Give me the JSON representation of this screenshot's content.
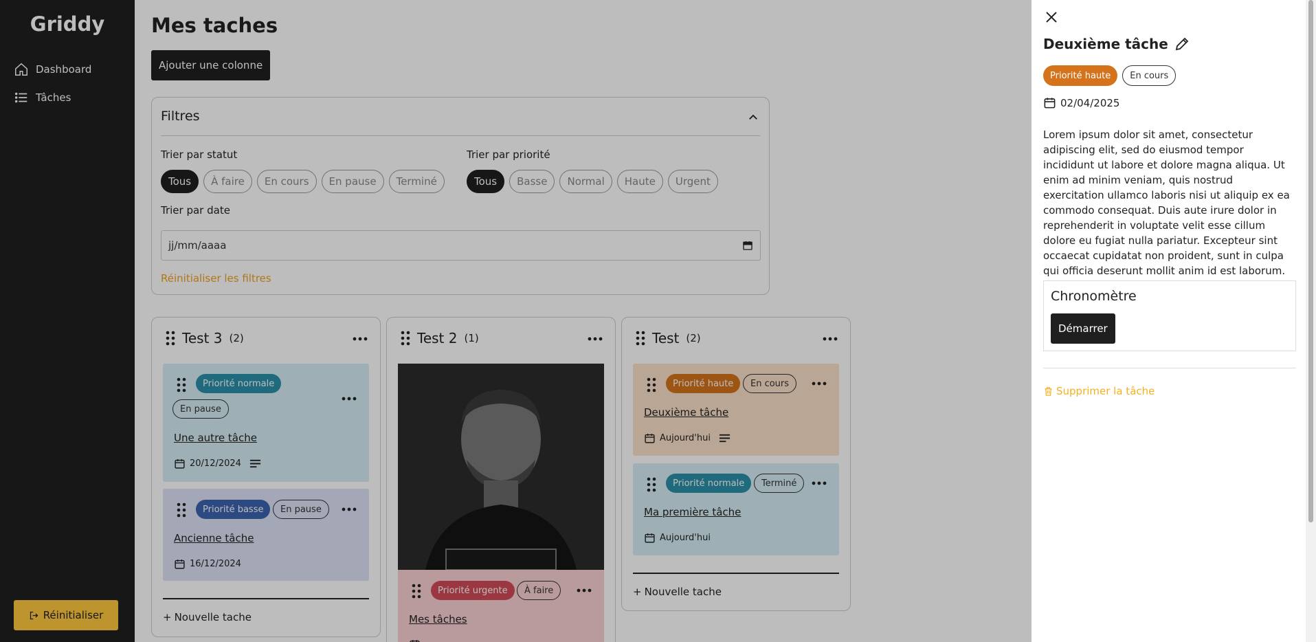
{
  "sidebar": {
    "logo": "Griddy",
    "nav": [
      {
        "label": "Dashboard",
        "icon": "home-icon"
      },
      {
        "label": "Tâches",
        "icon": "list-icon"
      }
    ],
    "reset_label": "Réinitialiser"
  },
  "main": {
    "title": "Mes taches",
    "add_column_label": "Ajouter une colonne",
    "filters": {
      "title": "Filtres",
      "status_label": "Trier par statut",
      "status_options": [
        "Tous",
        "À faire",
        "En cours",
        "En pause",
        "Terminé"
      ],
      "priority_label": "Trier par priorité",
      "priority_options": [
        "Tous",
        "Basse",
        "Normal",
        "Haute",
        "Urgent"
      ],
      "date_label": "Trier par date",
      "date_placeholder": "jj/mm/aaaa",
      "reset_label": "Réinitialiser les filtres"
    },
    "columns": [
      {
        "title": "Test 3",
        "count": "(2)",
        "new_task_label": "Nouvelle tache",
        "cards": [
          {
            "priority": "Priorité normale",
            "status": "En pause",
            "title": "Une autre tâche",
            "date": "20/12/2024"
          },
          {
            "priority": "Priorité basse",
            "status": "En pause",
            "title": "Ancienne tâche",
            "date": "16/12/2024"
          }
        ]
      },
      {
        "title": "Test 2",
        "count": "(1)",
        "cards": [
          {
            "priority": "Priorité urgente",
            "status": "À faire",
            "title": "Mes tâches"
          }
        ]
      },
      {
        "title": "Test",
        "count": "(2)",
        "new_task_label": "Nouvelle tache",
        "cards": [
          {
            "priority": "Priorité haute",
            "status": "En cours",
            "title": "Deuxième tâche",
            "date": "Aujourd'hui"
          },
          {
            "priority": "Priorité normale",
            "status": "Terminé",
            "title": "Ma première tâche",
            "date": "Aujourd'hui"
          }
        ]
      }
    ]
  },
  "drawer": {
    "title": "Deuxième tâche",
    "priority": "Priorité haute",
    "status": "En cours",
    "date": "02/04/2025",
    "description": "Lorem ipsum dolor sit amet, consectetur adipiscing elit, sed do eiusmod tempor incididunt ut labore et dolore magna aliqua. Ut enim ad minim veniam, quis nostrud exercitation ullamco laboris nisi ut aliquip ex ea commodo consequat. Duis aute irure dolor in reprehenderit in voluptate velit esse cillum dolore eu fugiat nulla pariatur. Excepteur sint occaecat cupidatat non proident, sunt in culpa qui officia deserunt mollit anim id est laborum.",
    "chrono_title": "Chronomètre",
    "chrono_start": "Démarrer",
    "delete_label": "Supprimer la tâche"
  },
  "colors": {
    "priority_normal": "#2a8fa8",
    "priority_basse": "#3d63b0",
    "priority_haute": "#d4731c",
    "priority_urgente": "#d04b57",
    "card_normal_bg": "#d5eef5",
    "card_basse_bg": "#dde3f6",
    "card_haute_bg": "#fbe0c9",
    "card_urgente_bg": "#fbd2d4",
    "accent": "#ffc83d"
  }
}
